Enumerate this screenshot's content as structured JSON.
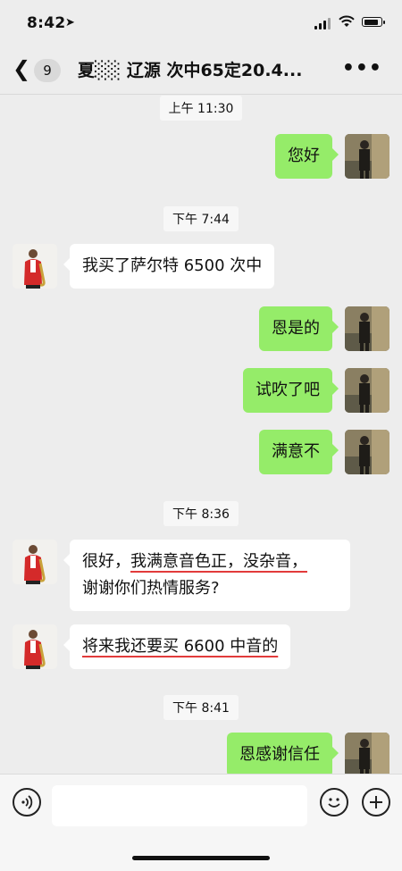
{
  "status_bar": {
    "time": "8:42"
  },
  "header": {
    "unread_count": "9",
    "title": "夏░░ 辽源 次中65定20.4..."
  },
  "messages": [
    {
      "timestamp": "上午 11:30"
    },
    {
      "me_1": "您好"
    },
    {
      "timestamp": "下午 7:44"
    },
    {
      "other_1": "我买了萨尔特 6500 次中"
    }
  ],
  "chat": {
    "ts1": "上午 11:30",
    "ts2": "下午 7:44",
    "ts3": "下午 8:36",
    "ts4": "下午 8:41",
    "m1": "您好",
    "m2": "我买了萨尔特 6500 次中",
    "m3": "恩是的",
    "m4": "试吹了吧",
    "m5": "满意不",
    "m6a": "很好，",
    "m6b": "我满意音色正，没杂音，",
    "m6c": "谢谢你们热情服务?",
    "m7": "将来我还要买 6600 中音的",
    "m8": "恩感谢信任"
  },
  "input": {
    "placeholder": ""
  },
  "icons": [
    "back-icon",
    "more-icon",
    "voice-icon",
    "emoji-icon",
    "add-icon"
  ],
  "colors": {
    "my_bubble": "#95ec69",
    "other_bubble": "#ffffff",
    "background": "#ededed",
    "underline": "#e23b3b"
  }
}
